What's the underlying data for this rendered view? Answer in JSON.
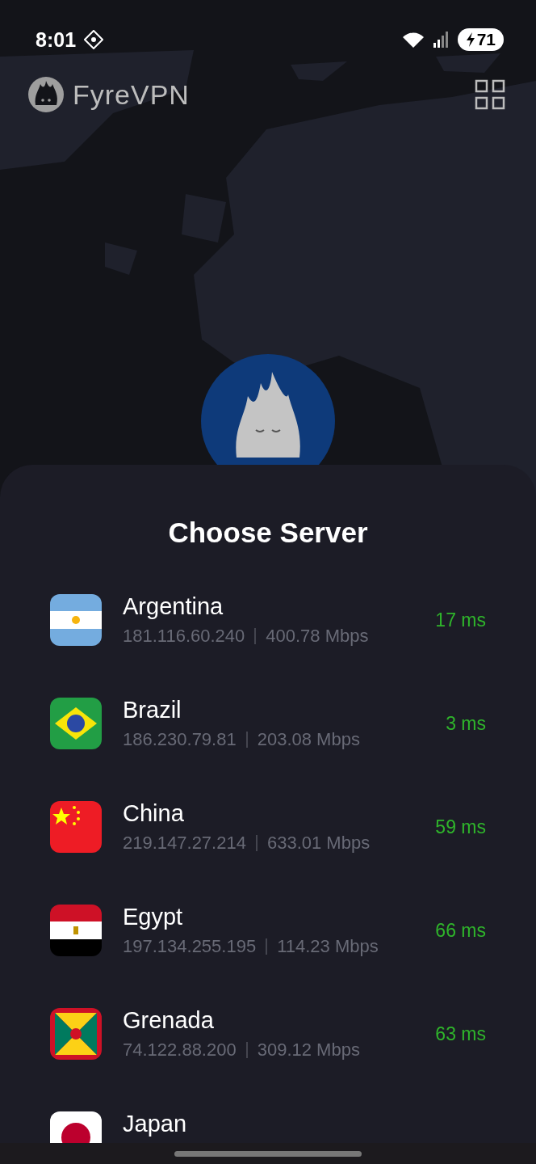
{
  "status_bar": {
    "time": "8:01",
    "battery": "71"
  },
  "header": {
    "app_name": "FyreVPN"
  },
  "sheet": {
    "title": "Choose Server",
    "servers": [
      {
        "name": "Argentina",
        "kind": "argentina",
        "ip": "181.116.60.240",
        "speed": "400.78 Mbps",
        "ping": "17 ms"
      },
      {
        "name": "Brazil",
        "kind": "brazil",
        "ip": "186.230.79.81",
        "speed": "203.08 Mbps",
        "ping": "3 ms"
      },
      {
        "name": "China",
        "kind": "china",
        "ip": "219.147.27.214",
        "speed": "633.01 Mbps",
        "ping": "59 ms"
      },
      {
        "name": "Egypt",
        "kind": "egypt",
        "ip": "197.134.255.195",
        "speed": "114.23 Mbps",
        "ping": "66 ms"
      },
      {
        "name": "Grenada",
        "kind": "grenada",
        "ip": "74.122.88.200",
        "speed": "309.12 Mbps",
        "ping": "63 ms"
      },
      {
        "name": "Japan",
        "kind": "japan"
      }
    ]
  }
}
